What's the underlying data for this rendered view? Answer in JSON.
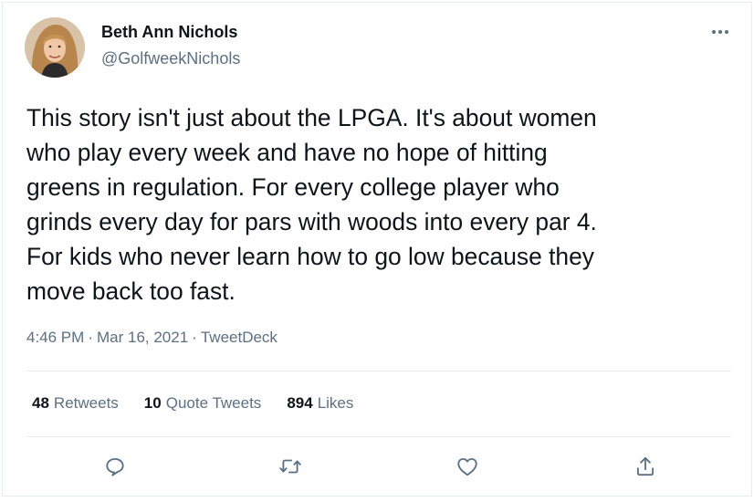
{
  "author": {
    "name": "Beth Ann Nichols",
    "handle": "@GolfweekNichols",
    "avatar_icon": "profile-photo"
  },
  "tweet": {
    "text": "This story isn't just about the LPGA. It's about women\nwho play every week and have no hope of hitting\ngreens in regulation. For every college player who\ngrinds every day for pars with woods into every par 4.\nFor kids who never learn how to go low because they\nmove back too fast.",
    "time": "4:46 PM",
    "date": "Mar 16, 2021",
    "separator": "·",
    "source": "TweetDeck"
  },
  "stats": {
    "retweets_count": "48",
    "retweets_label": "Retweets",
    "quote_count": "10",
    "quote_label": "Quote Tweets",
    "likes_count": "894",
    "likes_label": "Likes"
  },
  "icons": {
    "more": "more-horizontal-icon",
    "reply": "reply-icon",
    "retweet": "retweet-icon",
    "like": "heart-icon",
    "share": "share-icon"
  },
  "colors": {
    "text": "#0f1419",
    "secondary": "#5b7083",
    "border": "#e6ecf0"
  }
}
